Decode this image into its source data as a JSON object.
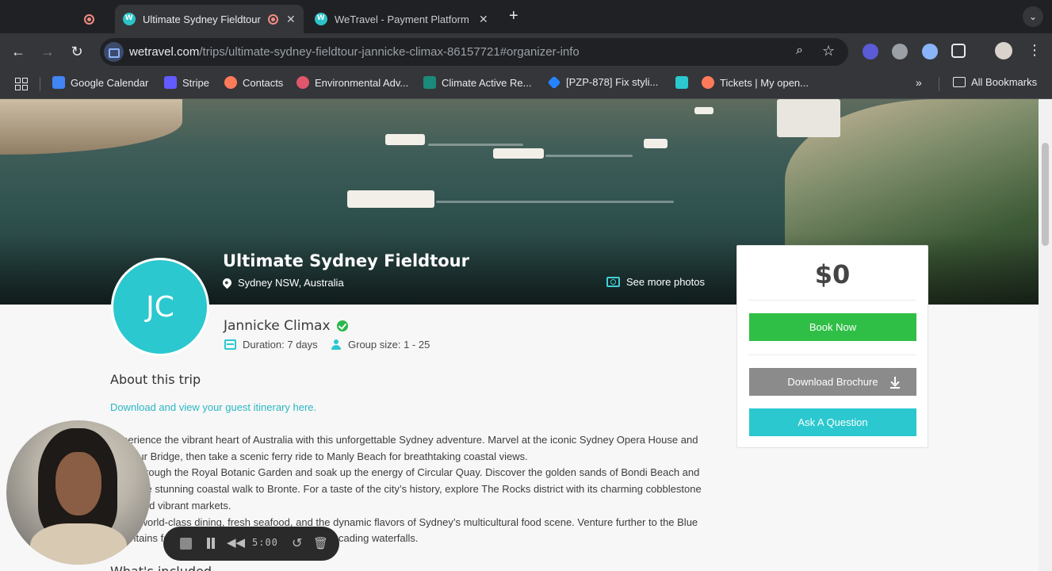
{
  "browser": {
    "tabs": [
      {
        "title": "",
        "type": "recording"
      },
      {
        "title": "Ultimate Sydney Fieldtour",
        "active": true
      },
      {
        "title": "WeTravel - Payment Platform",
        "active": false
      }
    ],
    "new_tab": "+",
    "url_host": "wetravel.com",
    "url_path": "/trips/ultimate-sydney-fieldtour-jannicke-climax-86157721#organizer-info",
    "bookmarks": [
      {
        "label": "Google Calendar",
        "icon": "calendar-icon",
        "color": "#4285f4"
      },
      {
        "label": "Stripe",
        "icon": "stripe-icon",
        "color": "#635bff"
      },
      {
        "label": "Contacts",
        "icon": "hubspot-icon",
        "color": "#ff7a59"
      },
      {
        "label": "Environmental Adv...",
        "icon": "asterisk-icon",
        "color": "#e0566b"
      },
      {
        "label": "Climate Active Re...",
        "icon": "climate-icon",
        "color": "#1b8a7a"
      },
      {
        "label": "[PZP-878] Fix styli...",
        "icon": "jira-icon",
        "color": "#2684ff"
      },
      {
        "label": "",
        "icon": "bookmark-icon",
        "color": "#2bc8cf"
      },
      {
        "label": "Tickets | My open...",
        "icon": "hubspot-icon",
        "color": "#ff7a59"
      }
    ],
    "all_bookmarks": "All Bookmarks"
  },
  "trip": {
    "title": "Ultimate Sydney Fieldtour",
    "location": "Sydney NSW, Australia",
    "see_photos": "See more photos",
    "avatar_initials": "JC",
    "organizer": "Jannicke Climax",
    "duration": "Duration: 7 days",
    "group_size": "Group size: 1 - 25",
    "about_heading": "About this trip",
    "itinerary_link": "Download and view your guest itinerary here.",
    "description": [
      "Experience the vibrant heart of Australia with this unforgettable Sydney adventure. Marvel at the iconic Sydney Opera House and",
      "Harbour Bridge, then take a scenic ferry ride to Manly Beach for breathtaking coastal views.",
      "Stroll through the Royal Botanic Garden and soak up the energy of Circular Quay. Discover the golden sands of Bondi Beach and",
      "enjoy the stunning coastal walk to Bronte. For a taste of the city’s history, explore The Rocks district with its charming cobblestone",
      "lanes and vibrant markets.",
      "Savor world-class dining, fresh seafood, and the dynamic flavors of Sydney’s multicultural food scene. Venture further to the Blue",
      "Mountains for dramatic cliffs, lush forests, and cascading waterfalls."
    ],
    "included_heading": "What's included"
  },
  "booking": {
    "price": "$0",
    "book_now": "Book Now",
    "download_brochure": "Download Brochure",
    "ask_question": "Ask A Question"
  },
  "recorder": {
    "time": "5:00"
  },
  "colors": {
    "accent": "#2bc8cf",
    "book_button": "#2fbf46",
    "brochure_button": "#8b8b8b"
  }
}
